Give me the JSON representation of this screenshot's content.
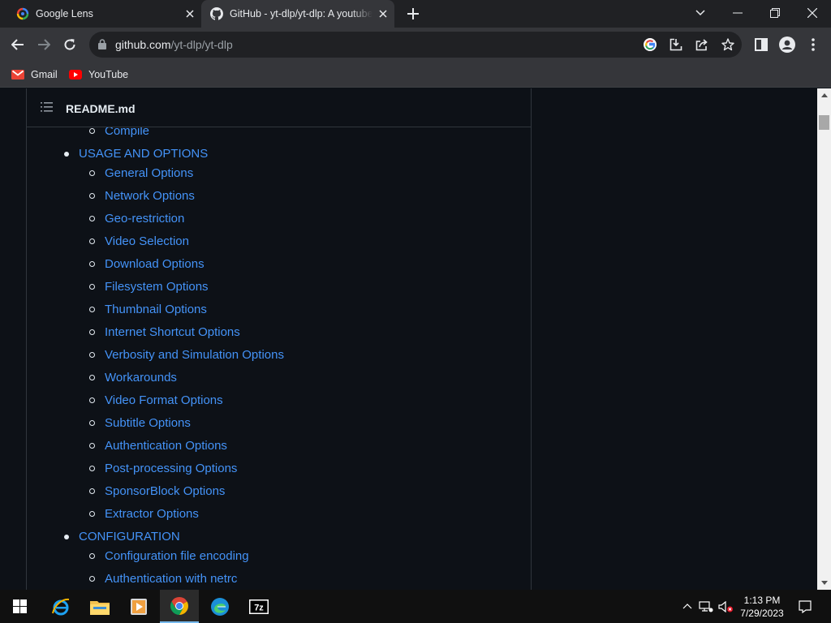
{
  "browser": {
    "tabs": [
      {
        "title": "Google Lens",
        "active": false,
        "icon": "google-lens-icon"
      },
      {
        "title": "GitHub - yt-dlp/yt-dlp: A youtube-dl fork",
        "active": true,
        "icon": "github-icon"
      }
    ],
    "toolbar": {
      "url_host": "github.com",
      "url_path": "/yt-dlp/yt-dlp"
    },
    "bookmarks": [
      {
        "label": "Gmail",
        "icon": "gmail-icon"
      },
      {
        "label": "YouTube",
        "icon": "youtube-icon"
      }
    ]
  },
  "readme": {
    "title": "README.md",
    "toc": {
      "partial_item": "Compile",
      "usage": {
        "label": "USAGE AND OPTIONS",
        "items": [
          "General Options",
          "Network Options",
          "Geo-restriction",
          "Video Selection",
          "Download Options",
          "Filesystem Options",
          "Thumbnail Options",
          "Internet Shortcut Options",
          "Verbosity and Simulation Options",
          "Workarounds",
          "Video Format Options",
          "Subtitle Options",
          "Authentication Options",
          "Post-processing Options",
          "SponsorBlock Options",
          "Extractor Options"
        ]
      },
      "configuration": {
        "label": "CONFIGURATION",
        "items": [
          "Configuration file encoding",
          "Authentication with netrc"
        ]
      }
    }
  },
  "taskbar": {
    "apps": [
      "start-icon",
      "internet-explorer-icon",
      "file-explorer-icon",
      "media-player-icon",
      "chrome-icon",
      "edge-icon",
      "7zip-icon"
    ],
    "clock_time": "1:13 PM",
    "clock_date": "7/29/2023"
  },
  "colors": {
    "link": "#4493f8",
    "page_bg": "#0d1117",
    "border": "#30363d"
  }
}
